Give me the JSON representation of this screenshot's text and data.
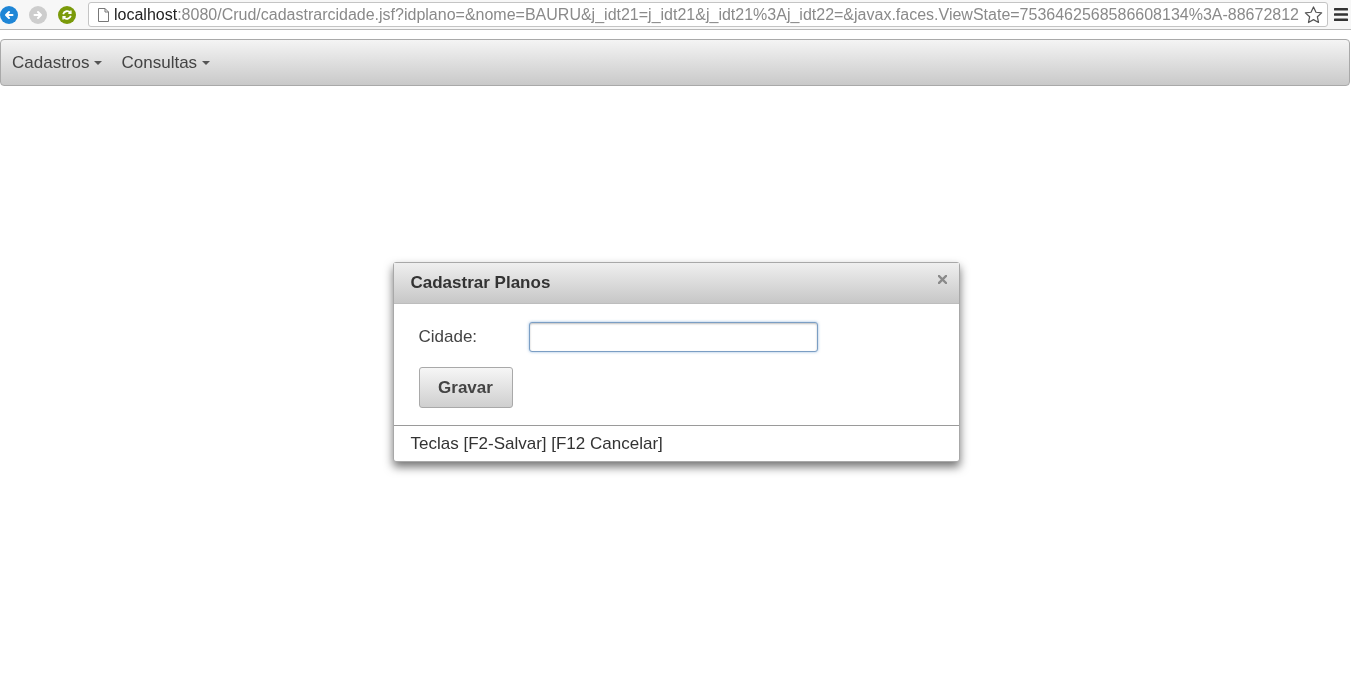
{
  "browser": {
    "nav_buttons": [
      {
        "kind": "back",
        "disabled": false
      },
      {
        "kind": "forward",
        "disabled": true
      },
      {
        "kind": "reload",
        "disabled": false
      }
    ],
    "address": {
      "host": "localhost",
      "path": ":8080/Crud/cadastrarcidade.jsf?idplano=&nome=BAURU&j_idt21=j_idt21&j_idt21%3Aj_idt22=&javax.faces.ViewState=7536462568586608134%3A-88672812"
    }
  },
  "navbar": {
    "menus": [
      {
        "label": "Cadastros"
      },
      {
        "label": "Consultas"
      }
    ]
  },
  "dialog": {
    "title": "Cadastrar Planos",
    "fields": [
      {
        "label": "Cidade:",
        "focused": true
      }
    ],
    "buttons": [
      {
        "label": "Gravar"
      }
    ],
    "footer": "Teclas [F2-Salvar] [F12 Cancelar]"
  }
}
